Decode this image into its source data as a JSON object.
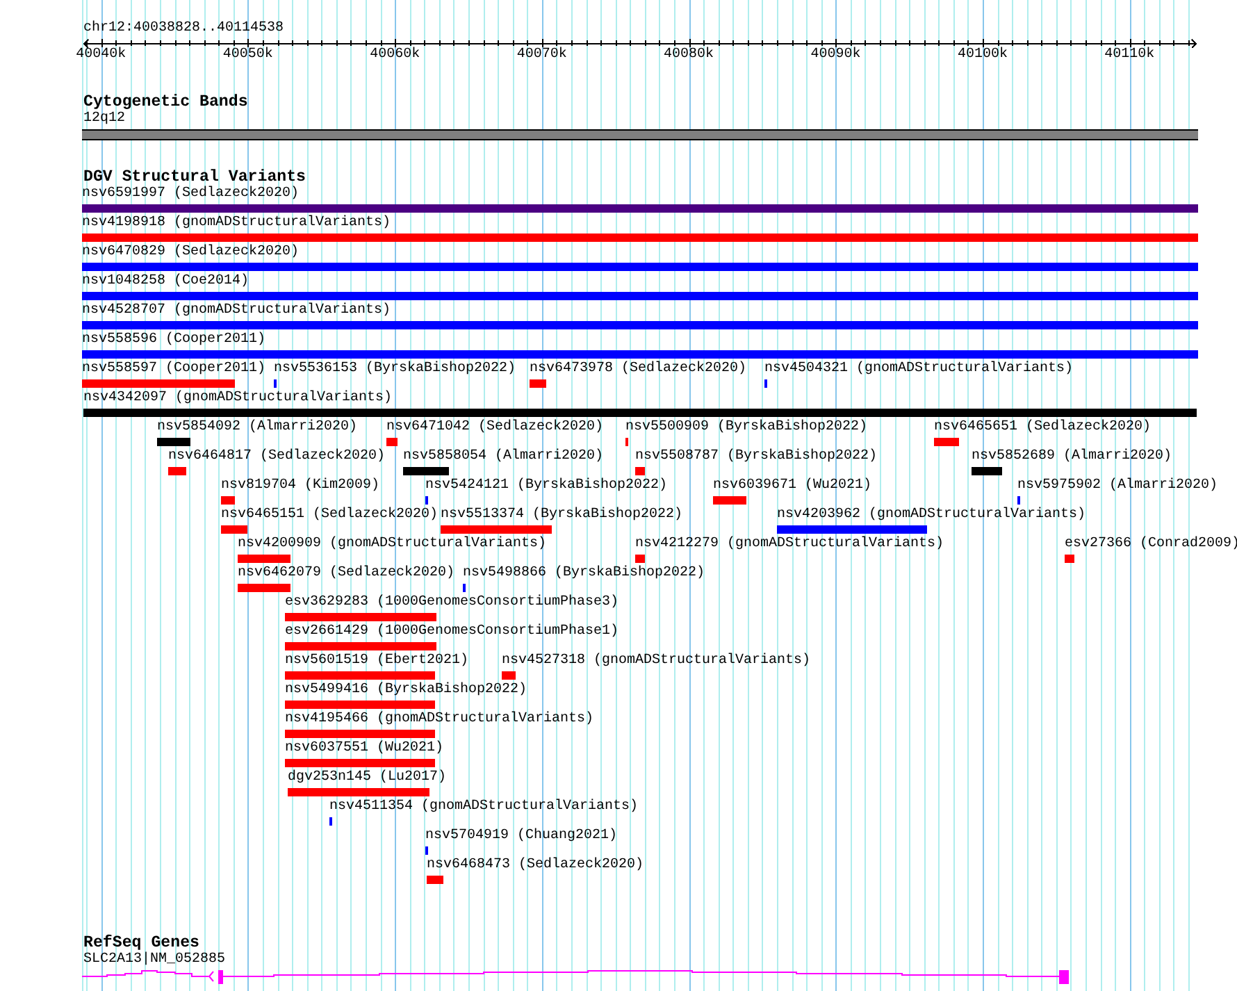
{
  "ruler": {
    "location": "chr12:40038828..40114538",
    "tick_labels": [
      "40040k",
      "40050k",
      "40060k",
      "40070k",
      "40080k",
      "40090k",
      "40100k",
      "40110k"
    ]
  },
  "tracks": [
    {
      "kind": "cytoband",
      "title": "Cytogenetic Bands",
      "features": [
        {
          "label": "12q12"
        }
      ]
    },
    {
      "kind": "variants",
      "title": "DGV Structural Variants",
      "features": [
        {
          "label": "nsv6591997 (Sedlazeck2020)",
          "color": "#4b0082"
        },
        {
          "label": "nsv4198918 (gnomADStructuralVariants)",
          "color": "#ff0000"
        },
        {
          "label": "nsv6470829 (Sedlazeck2020)",
          "color": "#0000ff"
        },
        {
          "label": "nsv1048258 (Coe2014)",
          "color": "#0000ff"
        },
        {
          "label": "nsv4528707 (gnomADStructuralVariants)",
          "color": "#0000ff"
        },
        {
          "label": "nsv558596 (Cooper2011)",
          "color": "#0000ff"
        },
        {
          "label": "nsv558597 (Cooper2011)",
          "color": "#ff0000"
        },
        {
          "label": "nsv5536153 (ByrskaBishop2022)",
          "color": "#0000ff"
        },
        {
          "label": "nsv6473978 (Sedlazeck2020)",
          "color": "#ff0000"
        },
        {
          "label": "nsv4504321 (gnomADStructuralVariants)",
          "color": "#0000ff"
        },
        {
          "label": "nsv4342097 (gnomADStructuralVariants)",
          "color": "#000000"
        },
        {
          "label": "nsv5854092 (Almarri2020)",
          "color": "#000000"
        },
        {
          "label": "nsv6471042 (Sedlazeck2020)",
          "color": "#ff0000"
        },
        {
          "label": "nsv5500909 (ByrskaBishop2022)",
          "color": "#ff0000"
        },
        {
          "label": "nsv6465651 (Sedlazeck2020)",
          "color": "#ff0000"
        },
        {
          "label": "nsv6464817 (Sedlazeck2020)",
          "color": "#ff0000"
        },
        {
          "label": "nsv5858054 (Almarri2020)",
          "color": "#000000"
        },
        {
          "label": "nsv5508787 (ByrskaBishop2022)",
          "color": "#ff0000"
        },
        {
          "label": "nsv5852689 (Almarri2020)",
          "color": "#000000"
        },
        {
          "label": "nsv819704 (Kim2009)",
          "color": "#ff0000"
        },
        {
          "label": "nsv5424121 (ByrskaBishop2022)",
          "color": "#0000ff"
        },
        {
          "label": "nsv6039671 (Wu2021)",
          "color": "#ff0000"
        },
        {
          "label": "nsv5975902 (Almarri2020)",
          "color": "#0000ff"
        },
        {
          "label": "nsv6465151 (Sedlazeck2020)",
          "color": "#ff0000"
        },
        {
          "label": "nsv5513374 (ByrskaBishop2022)",
          "color": "#ff0000"
        },
        {
          "label": "nsv4203962 (gnomADStructuralVariants)",
          "color": "#0000ff"
        },
        {
          "label": "nsv4200909 (gnomADStructuralVariants)",
          "color": "#ff0000"
        },
        {
          "label": "nsv4212279 (gnomADStructuralVariants)",
          "color": "#ff0000"
        },
        {
          "label": "esv27366 (Conrad2009)",
          "color": "#ff0000"
        },
        {
          "label": "nsv6462079 (Sedlazeck2020)",
          "color": "#ff0000"
        },
        {
          "label": "nsv5498866 (ByrskaBishop2022)",
          "color": "#0000ff"
        },
        {
          "label": "esv3629283 (1000GenomesConsortiumPhase3)",
          "color": "#ff0000"
        },
        {
          "label": "esv2661429 (1000GenomesConsortiumPhase1)",
          "color": "#ff0000"
        },
        {
          "label": "nsv5601519 (Ebert2021)",
          "color": "#ff0000"
        },
        {
          "label": "nsv4527318 (gnomADStructuralVariants)",
          "color": "#ff0000"
        },
        {
          "label": "nsv5499416 (ByrskaBishop2022)",
          "color": "#ff0000"
        },
        {
          "label": "nsv4195466 (gnomADStructuralVariants)",
          "color": "#ff0000"
        },
        {
          "label": "nsv6037551 (Wu2021)",
          "color": "#ff0000"
        },
        {
          "label": "dgv253n145 (Lu2017)",
          "color": "#ff0000"
        },
        {
          "label": "nsv4511354 (gnomADStructuralVariants)",
          "color": "#0000ff"
        },
        {
          "label": "nsv5704919 (Chuang2021)",
          "color": "#0000ff"
        },
        {
          "label": "nsv6468473 (Sedlazeck2020)",
          "color": "#ff0000"
        }
      ]
    },
    {
      "kind": "genes",
      "title": "RefSeq Genes",
      "features": [
        {
          "label": "SLC2A13|NM_052885"
        }
      ]
    }
  ]
}
